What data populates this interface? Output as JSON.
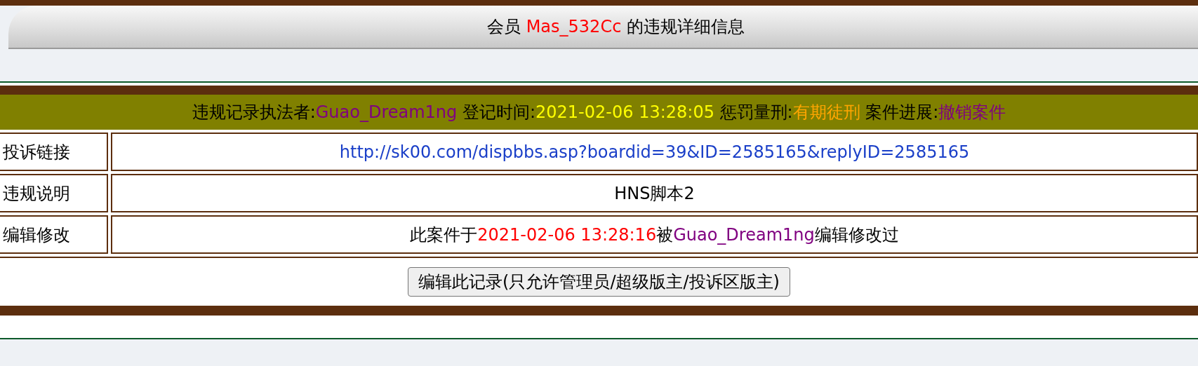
{
  "title": [
    {
      "text": "会员 ",
      "color": "#000000"
    },
    {
      "text": "Mas_532Cc",
      "color": "#ff0000"
    },
    {
      "text": " 的违规详细信息",
      "color": "#000000"
    }
  ],
  "summary": [
    {
      "text": "违规记录执法者:",
      "color": "#000000"
    },
    {
      "text": "Guao_Dream1ng",
      "color": "#800080"
    },
    {
      "text": " 登记时间:",
      "color": "#000000"
    },
    {
      "text": "2021-02-06 13:28:05",
      "color": "#ffff00"
    },
    {
      "text": " 惩罚量刑:",
      "color": "#000000"
    },
    {
      "text": "有期徒刑",
      "color": "#ffa500"
    },
    {
      "text": " 案件进展:",
      "color": "#000000"
    },
    {
      "text": "撤销案件",
      "color": "#800080"
    }
  ],
  "rows": [
    {
      "label": "投诉链接",
      "value": [
        {
          "text": "http://sk00.com/dispbbs.asp?boardid=39&ID=2585165&replyID=2585165",
          "color": "#1a3fc8"
        }
      ]
    },
    {
      "label": "违规说明",
      "value": [
        {
          "text": "HNS脚本2",
          "color": "#000000"
        }
      ]
    },
    {
      "label": "编辑修改",
      "value": [
        {
          "text": "此案件于",
          "color": "#000000"
        },
        {
          "text": "2021-02-06 13:28:16",
          "color": "#ff0000"
        },
        {
          "text": "被",
          "color": "#000000"
        },
        {
          "text": "Guao_Dream1ng",
          "color": "#800080"
        },
        {
          "text": "编辑修改过",
          "color": "#000000"
        }
      ]
    }
  ],
  "edit_button": "编辑此记录(只允许管理员/超级版主/投诉区版主)"
}
